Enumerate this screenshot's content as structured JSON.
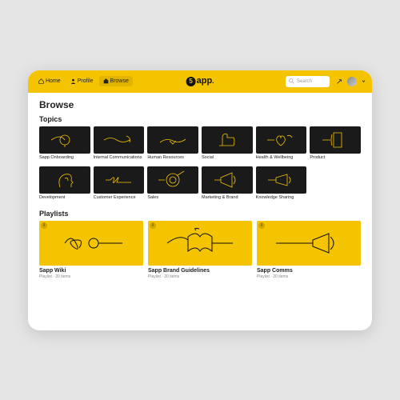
{
  "nav": {
    "home": "Home",
    "profile": "Profile",
    "browse": "Browse"
  },
  "brand": {
    "five": "5",
    "name": "app",
    "dot": "."
  },
  "search": {
    "placeholder": "Search"
  },
  "page": {
    "title": "Browse",
    "section_topics": "Topics",
    "section_playlists": "Playlists"
  },
  "topics_row1": [
    {
      "label": "Sapp Onboarding",
      "icon": "lightbulb"
    },
    {
      "label": "Internal Communications",
      "icon": "thread"
    },
    {
      "label": "Human Resources",
      "icon": "handshake"
    },
    {
      "label": "Social",
      "icon": "thumbsup"
    },
    {
      "label": "Health & Wellbeing",
      "icon": "heart"
    },
    {
      "label": "Product",
      "icon": "phone"
    }
  ],
  "topics_row2": [
    {
      "label": "Development",
      "icon": "head"
    },
    {
      "label": "Customer Experience",
      "icon": "tangle"
    },
    {
      "label": "Sales",
      "icon": "target"
    },
    {
      "label": "Marketing & Brand",
      "icon": "megaphone"
    },
    {
      "label": "Knowledge Sharing",
      "icon": "megaphone2"
    }
  ],
  "playlists": [
    {
      "title": "Sapp Wiki",
      "meta": "Playlist · 20 items",
      "icon": "scribble"
    },
    {
      "title": "Sapp Brand Guidelines",
      "meta": "Playlist · 20 items",
      "icon": "book"
    },
    {
      "title": "Sapp Comms",
      "meta": "Playlist · 20 items",
      "icon": "horn"
    }
  ],
  "info_badge": "i"
}
